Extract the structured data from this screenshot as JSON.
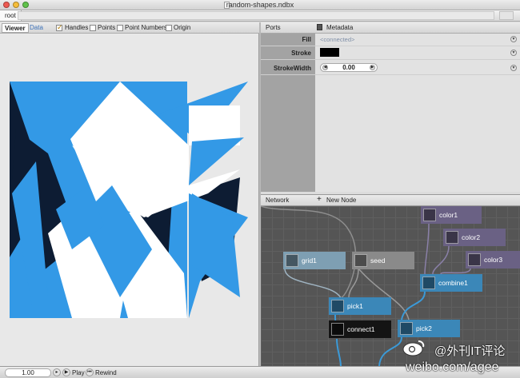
{
  "window": {
    "title": "random-shapes.ndbx"
  },
  "address": {
    "root": "root"
  },
  "viewer": {
    "tabs": [
      "Viewer",
      "Data"
    ],
    "options": [
      {
        "label": "Handles",
        "checked": true
      },
      {
        "label": "Points",
        "checked": false
      },
      {
        "label": "Point Numbers",
        "checked": false
      },
      {
        "label": "Origin",
        "checked": false
      }
    ],
    "colors": {
      "blue": "#3399e6",
      "navy": "#0d1c33",
      "white": "#ffffff",
      "background": "#e8e8e8"
    }
  },
  "ports": {
    "header": "Ports",
    "metadata_label": "Metadata",
    "rows": [
      {
        "label": "Fill",
        "value": "<connected>"
      },
      {
        "label": "Stroke",
        "value": "",
        "swatch": "#000000"
      },
      {
        "label": "StrokeWidth",
        "value": "0.00"
      }
    ]
  },
  "network": {
    "header": "Network",
    "new_node_label": "New Node",
    "nodes": [
      {
        "name": "color1",
        "color": "#6a6184",
        "icon": "color-icon"
      },
      {
        "name": "color2",
        "color": "#6a6184",
        "icon": "color-icon"
      },
      {
        "name": "color3",
        "color": "#6a6184",
        "icon": "color-icon"
      },
      {
        "name": "grid1",
        "color": "#7e9fb3",
        "icon": "grid-icon"
      },
      {
        "name": "seed",
        "color": "#8a8a8a",
        "icon": "seed-icon"
      },
      {
        "name": "combine1",
        "color": "#3b87b8",
        "icon": "combine-icon"
      },
      {
        "name": "pick1",
        "color": "#3b87b8",
        "icon": "pick-icon"
      },
      {
        "name": "connect1",
        "color": "#141414",
        "icon": "connect-icon"
      },
      {
        "name": "pick2",
        "color": "#3b87b8",
        "icon": "pick-icon"
      }
    ]
  },
  "bottom": {
    "zoom": "1.00",
    "play_label": "Play",
    "rewind_label": "Rewind"
  },
  "watermark": {
    "line1": "@外刊IT评论",
    "line2": "weibo.com/agee"
  }
}
